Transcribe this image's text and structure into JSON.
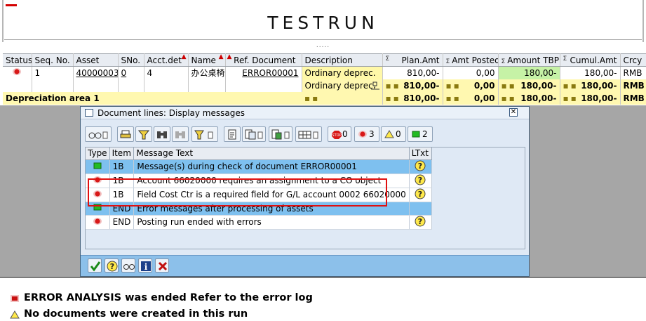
{
  "header": {
    "title": "TESTRUN"
  },
  "grid": {
    "columns": [
      "Status",
      "Seq. No.",
      "Asset",
      "SNo.",
      "Acct.det",
      "Name",
      "Ref. Document",
      "Description",
      "Plan.Amt",
      "Amt Posted",
      "Amount TBP",
      "Cumul.Amt",
      "Crcy"
    ],
    "row1": {
      "seq": "1",
      "asset": "40000003",
      "sno": "0",
      "acctdet": "4",
      "name": "办公桌椅",
      "refdoc": "ERROR00001",
      "desc": "Ordinary deprec.",
      "plan": "810,00-",
      "posted": "0,00",
      "tbp": "180,00-",
      "cumul": "180,00-",
      "crcy": "RMB"
    },
    "row2": {
      "desc": "Ordinary deprec.",
      "plan": "810,00-",
      "posted": "0,00",
      "tbp": "180,00-",
      "cumul": "180,00-",
      "crcy": "RMB"
    },
    "row3": {
      "label": "Depreciation area  1",
      "plan": "810,00-",
      "posted": "0,00",
      "tbp": "180,00-",
      "cumul": "180,00-",
      "crcy": "RMB"
    }
  },
  "dialog": {
    "title": "Document lines: Display messages",
    "counts": {
      "stop": "0",
      "error": "3",
      "warning": "0",
      "success": "2"
    },
    "columns": [
      "Type",
      "Item",
      "Message Text",
      "LTxt"
    ],
    "rows": [
      {
        "type": "success",
        "item": "1B",
        "text": "Message(s) during check of document ERROR00001",
        "ltxt": true
      },
      {
        "type": "error",
        "item": "1B",
        "text": "Account 66020000 requires an assignment to a CO object",
        "ltxt": true
      },
      {
        "type": "error",
        "item": "1B",
        "text": "Field Cost Ctr is a required field for G/L account 0002 66020000",
        "ltxt": true
      },
      {
        "type": "success",
        "item": "END",
        "text": "Error messages after processing of assets",
        "ltxt": false
      },
      {
        "type": "error",
        "item": "END",
        "text": "Posting run ended with errors",
        "ltxt": true
      }
    ]
  },
  "status": {
    "line1": "ERROR ANALYSIS was ended Refer to the error log",
    "line2": "No documents were created in this run"
  }
}
